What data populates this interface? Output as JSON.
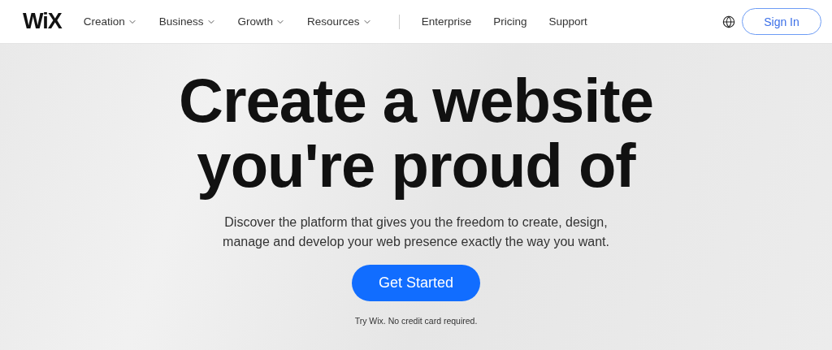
{
  "header": {
    "logo": "WiX",
    "nav": [
      {
        "label": "Creation",
        "kind": "menu"
      },
      {
        "label": "Business",
        "kind": "menu"
      },
      {
        "label": "Growth",
        "kind": "menu"
      },
      {
        "label": "Resources",
        "kind": "menu"
      },
      {
        "label": "Enterprise",
        "kind": "link"
      },
      {
        "label": "Pricing",
        "kind": "link"
      },
      {
        "label": "Support",
        "kind": "link"
      }
    ],
    "sign_in": "Sign In"
  },
  "hero": {
    "headline": [
      "Create a website",
      "you're proud of"
    ],
    "description": "Discover the platform that gives you the freedom to create, design, manage and develop your web presence exactly the way you want.",
    "cta": "Get Started",
    "note": "Try Wix. No credit card required."
  }
}
